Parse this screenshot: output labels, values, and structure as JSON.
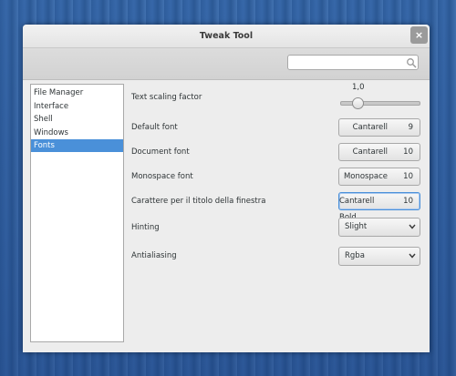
{
  "window": {
    "title": "Tweak Tool",
    "close_glyph": "×"
  },
  "search": {
    "placeholder": "",
    "value": "",
    "icon": "search-icon"
  },
  "sidebar": {
    "items": [
      {
        "label": "File Manager",
        "selected": false
      },
      {
        "label": "Interface",
        "selected": false
      },
      {
        "label": "Shell",
        "selected": false
      },
      {
        "label": "Windows",
        "selected": false
      },
      {
        "label": "Fonts",
        "selected": true
      }
    ]
  },
  "settings": {
    "text_scaling": {
      "label": "Text scaling factor",
      "value_text": "1,0",
      "value": 1.0,
      "min": 0.5,
      "max": 3.0
    },
    "default_font": {
      "label": "Default font",
      "font": "Cantarell",
      "size": "9"
    },
    "document_font": {
      "label": "Document font",
      "font": "Cantarell",
      "size": "10"
    },
    "monospace_font": {
      "label": "Monospace font",
      "font": "Monospace",
      "size": "10"
    },
    "title_font": {
      "label": "Carattere per il titolo della finestra",
      "font": "Cantarell Bold",
      "size": "10"
    },
    "hinting": {
      "label": "Hinting",
      "value": "Slight"
    },
    "antialiasing": {
      "label": "Antialiasing",
      "value": "Rgba"
    }
  },
  "colors": {
    "selection": "#4a90d9",
    "window_bg": "#ededed"
  }
}
